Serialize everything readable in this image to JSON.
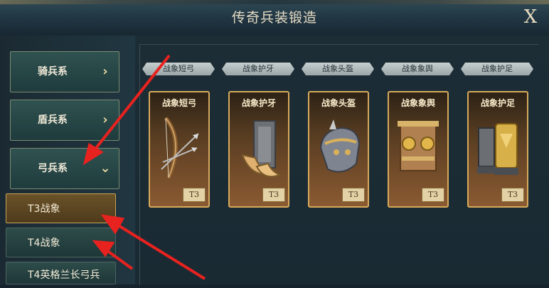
{
  "window": {
    "title": "传奇兵装锻造",
    "close_label": "X"
  },
  "sidebar": {
    "categories": [
      {
        "label": "骑兵系",
        "chevron": "›"
      },
      {
        "label": "盾兵系",
        "chevron": "›"
      },
      {
        "label": "弓兵系",
        "chevron": "⌄"
      }
    ],
    "subitems": [
      {
        "label": "T3战象",
        "selected": true
      },
      {
        "label": "T4战象",
        "selected": false
      },
      {
        "label": "T4英格兰长弓兵",
        "selected": false
      }
    ]
  },
  "items": [
    {
      "ribbon": "战象短弓",
      "name": "战象短弓",
      "tier": "T3"
    },
    {
      "ribbon": "战象护牙",
      "name": "战象护牙",
      "tier": "T3"
    },
    {
      "ribbon": "战象头盔",
      "name": "战象头盔",
      "tier": "T3"
    },
    {
      "ribbon": "战象象舆",
      "name": "战象象舆",
      "tier": "T3"
    },
    {
      "ribbon": "战象护足",
      "name": "战象护足",
      "tier": "T3"
    }
  ],
  "colors": {
    "accent_gold": "#d6a95c",
    "arrow_red": "#e8221f",
    "selected_gold": "#c9a456"
  }
}
